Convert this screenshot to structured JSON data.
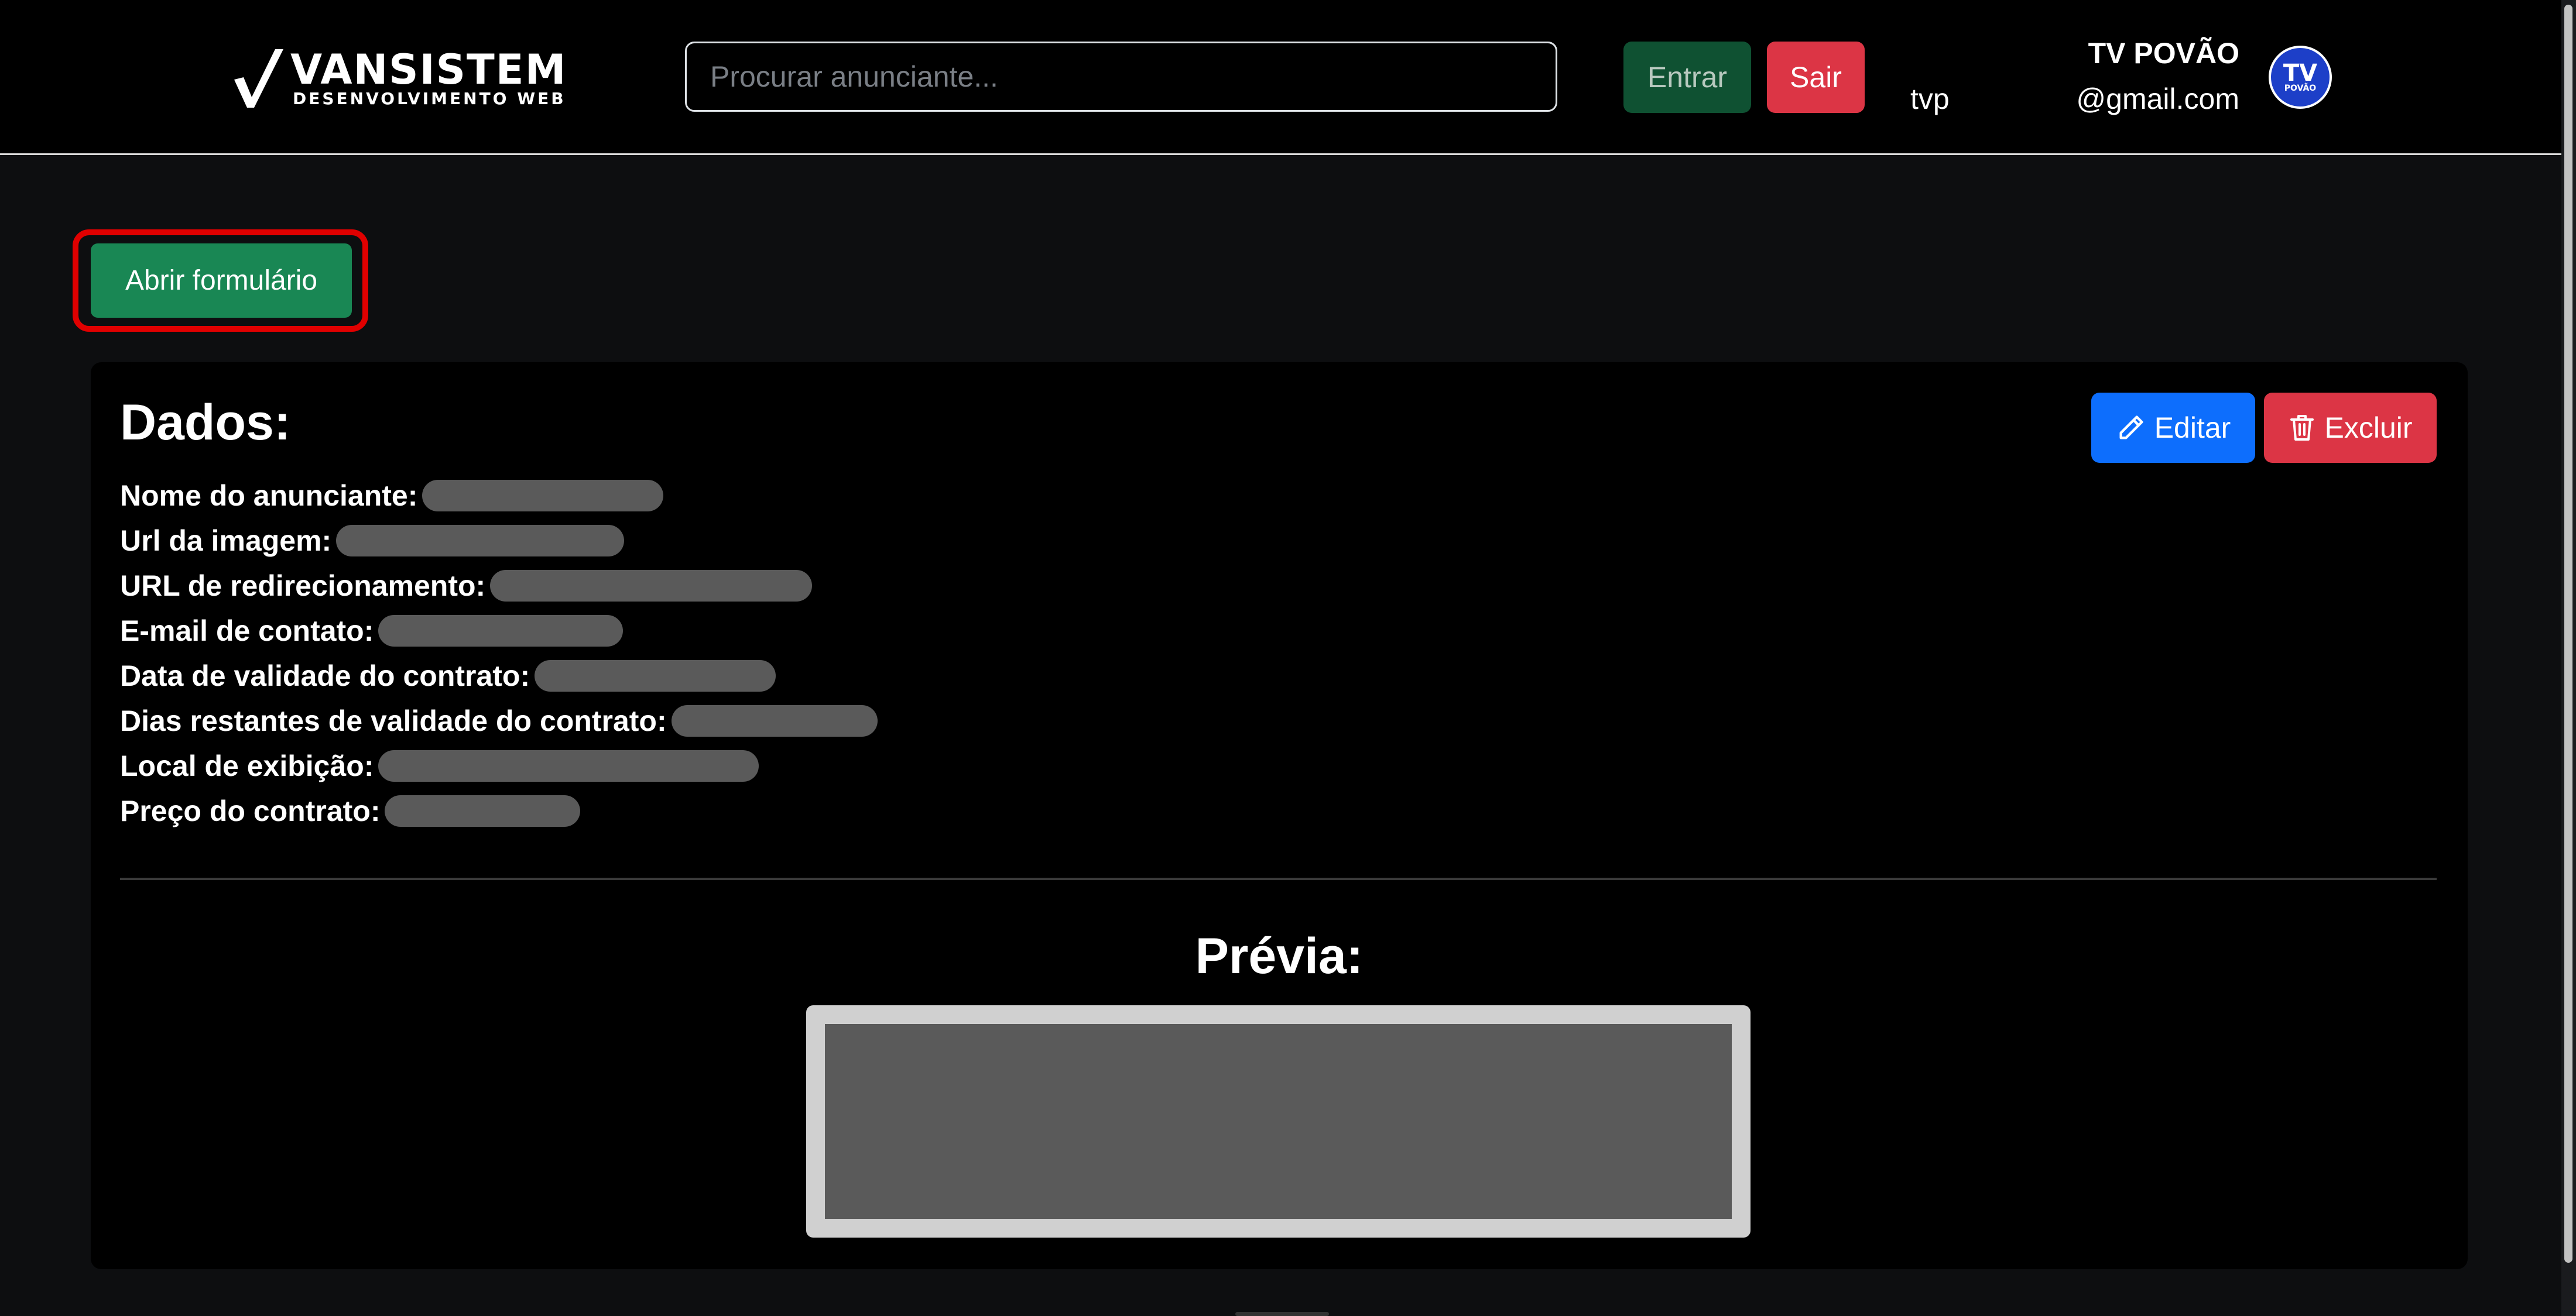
{
  "brand": {
    "name": "VANSISTEM",
    "tagline": "DESENVOLVIMENTO WEB"
  },
  "search": {
    "placeholder": "Procurar anunciante..."
  },
  "auth": {
    "login_label": "Entrar",
    "logout_label": "Sair"
  },
  "user": {
    "handle": "tvp",
    "name": "TV POVÃO",
    "email": "@gmail.com",
    "avatar_text": "TV",
    "avatar_subtext": "POVÃO"
  },
  "actions": {
    "open_form_label": "Abrir formulário"
  },
  "card": {
    "title": "Dados:",
    "edit_label": "Editar",
    "delete_label": "Excluir",
    "fields": [
      {
        "label": "Nome do anunciante:",
        "value_redacted": true
      },
      {
        "label": "Url da imagem:",
        "value_redacted": true
      },
      {
        "label": "URL de redirecionamento:",
        "value_redacted": true
      },
      {
        "label": "E-mail de contato:",
        "value_redacted": true
      },
      {
        "label": "Data de validade do contrato:",
        "value_redacted": true
      },
      {
        "label": "Dias restantes de validade do contrato:",
        "value_redacted": true
      },
      {
        "label": "Local de exibição:",
        "value_redacted": true
      },
      {
        "label": "Preço do contrato:",
        "value_redacted": true
      }
    ],
    "preview_title": "Prévia:"
  },
  "icons": {
    "brand": "vansistem-logo-mark",
    "edit": "pencil-icon",
    "delete": "trash-icon"
  },
  "colors": {
    "background": "#0d0e10",
    "navbar": "#000000",
    "success": "#198754",
    "success_dark": "#0f5132",
    "danger": "#dc3545",
    "primary": "#0d6efd",
    "highlight": "#e00000",
    "redacted": "#5a5a5a"
  }
}
